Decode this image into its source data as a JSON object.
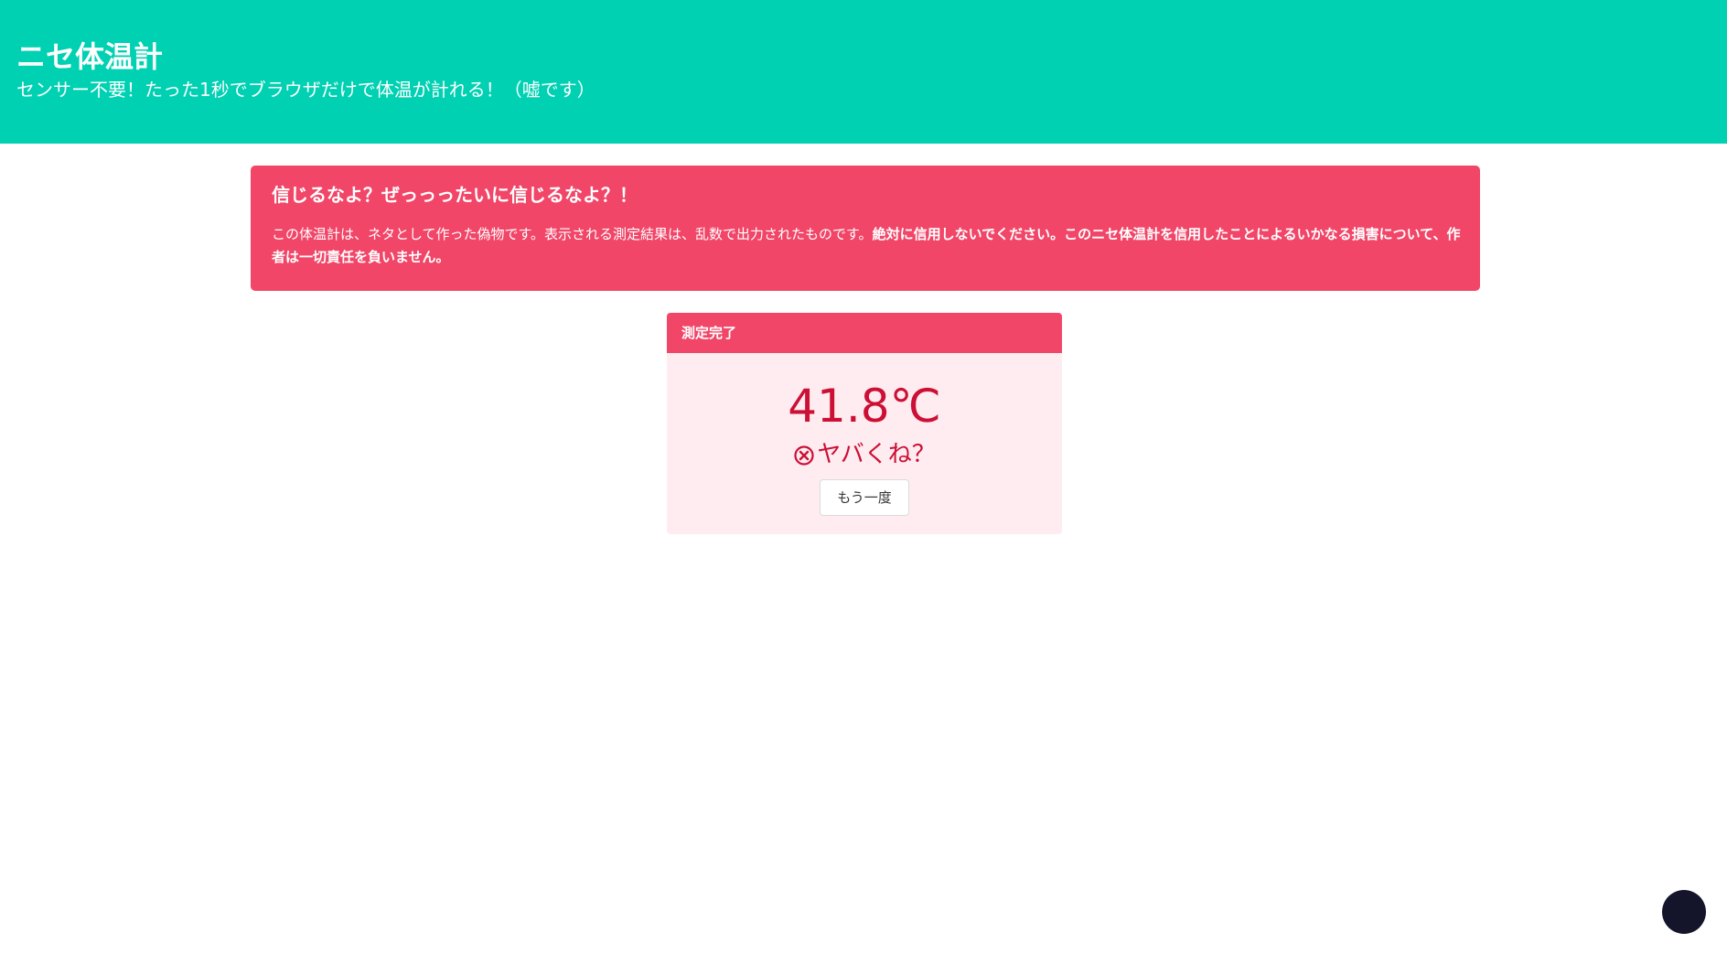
{
  "hero": {
    "title": "ニセ体温計",
    "subtitle": "センサー不要！たった1秒でブラウザだけで体温が計れる！（嘘です）"
  },
  "warning": {
    "title": "信じるなよ？ぜっっったいに信じるなよ？！",
    "body_normal": "この体温計は、ネタとして作った偽物です。表示される測定結果は、乱数で出力されたものです。",
    "body_bold": "絶対に信用しないでください。このニセ体温計を信用したことによるいかなる損害について、作者は一切責任を負いません。"
  },
  "result": {
    "header": "測定完了",
    "temperature": "41.8℃",
    "status_text": "ヤバくね？",
    "status_icon": "circle-x-icon",
    "retry_label": "もう一度"
  },
  "colors": {
    "hero_bg": "#00d1b2",
    "danger": "#f14668",
    "danger_light": "#feecf0",
    "danger_text": "#cc0f35",
    "fab": "#14142b"
  }
}
